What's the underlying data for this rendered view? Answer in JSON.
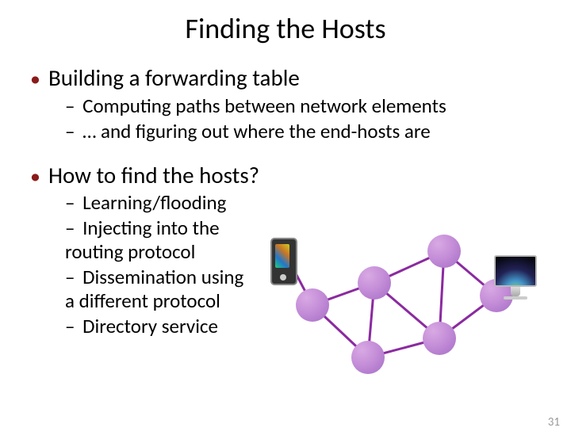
{
  "title": "Finding the Hosts",
  "section1": {
    "heading": "Building a forwarding table",
    "items": [
      "Computing paths between network elements",
      "… and figuring out where the end-hosts are"
    ]
  },
  "section2": {
    "heading": "How to find the hosts?",
    "items": [
      "Learning/flooding",
      "Injecting into the routing protocol",
      "Dissemination using a different protocol",
      "Directory service"
    ]
  },
  "page_number": "31"
}
